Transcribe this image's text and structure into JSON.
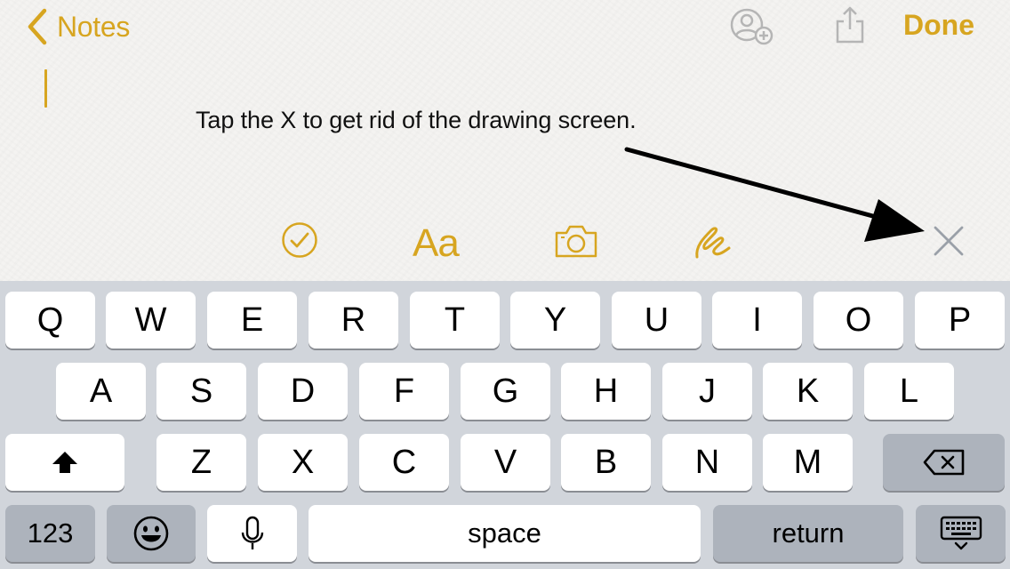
{
  "nav": {
    "back_label": "Notes",
    "done_label": "Done"
  },
  "note": {
    "instruction": "Tap the X to get rid of the drawing screen."
  },
  "toolbar": {
    "format_label": "Aa",
    "items": [
      "checklist-icon",
      "format-text",
      "camera-icon",
      "sketch-icon",
      "close-icon"
    ]
  },
  "keyboard": {
    "row1": [
      "Q",
      "W",
      "E",
      "R",
      "T",
      "Y",
      "U",
      "I",
      "O",
      "P"
    ],
    "row2": [
      "A",
      "S",
      "D",
      "F",
      "G",
      "H",
      "J",
      "K",
      "L"
    ],
    "row3": [
      "Z",
      "X",
      "C",
      "V",
      "B",
      "N",
      "M"
    ],
    "numbers_label": "123",
    "space_label": "space",
    "return_label": "return"
  },
  "colors": {
    "accent": "#d7a520",
    "keyboard_bg": "#d1d5db",
    "key_dark": "#adb3bc",
    "close_gray": "#9aa0a8"
  }
}
